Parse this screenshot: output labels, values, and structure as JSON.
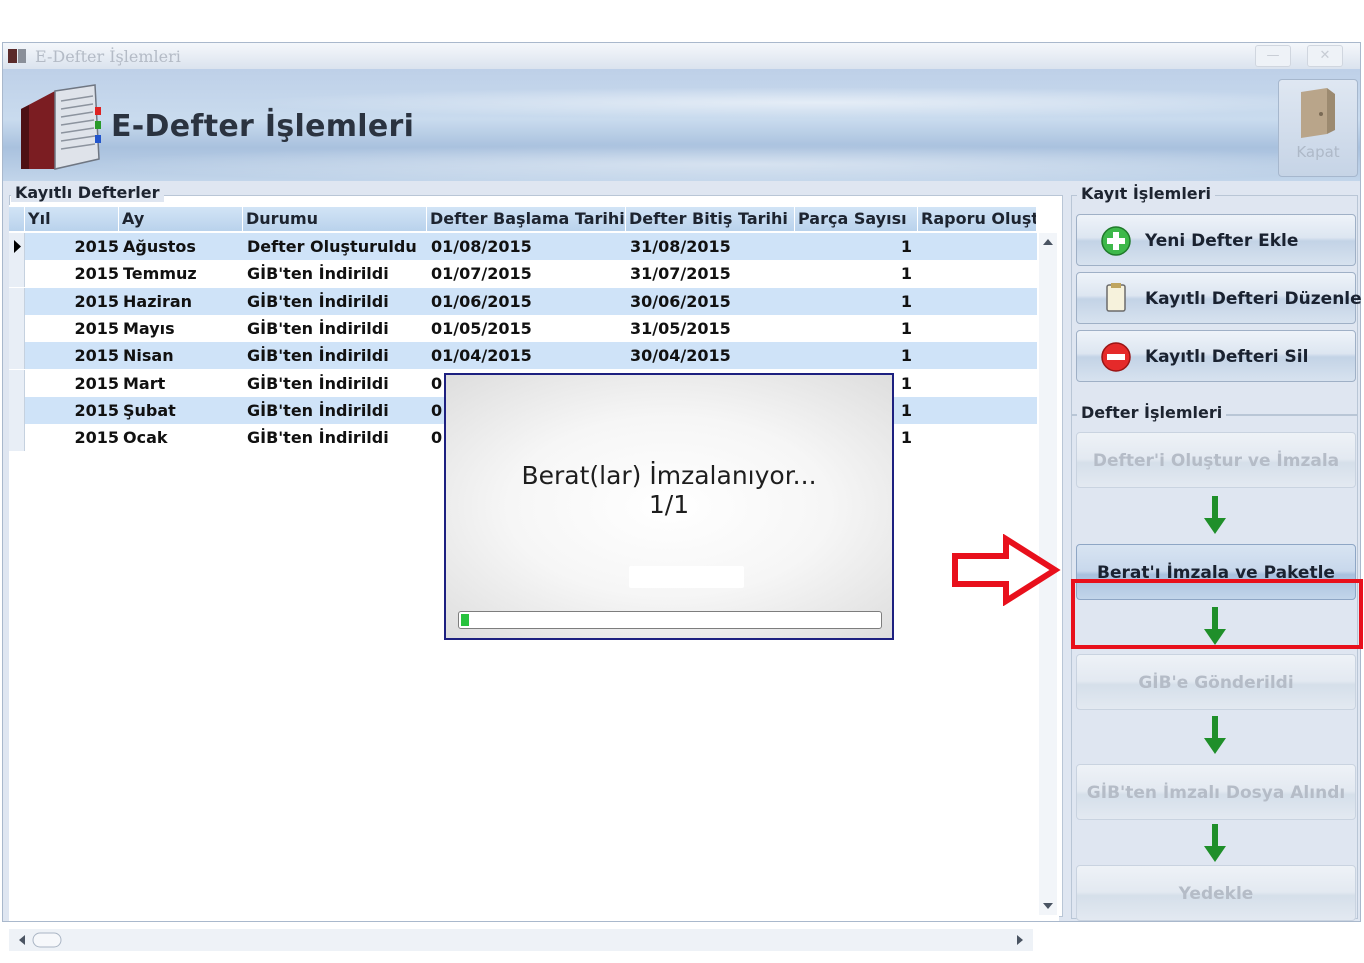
{
  "window": {
    "title": "E-Defter İşlemleri",
    "header_title": "E-Defter İşlemleri",
    "close_label": "Kapat",
    "minimize_glyph": "—",
    "close_glyph": "✕"
  },
  "grid": {
    "section_label": "Kayıtlı Defterler",
    "columns": [
      "Yıl",
      "Ay",
      "Durumu",
      "Defter Başlama Tarihi",
      "Defter Bitiş Tarihi",
      "Parça Sayısı",
      "Raporu Oluşt"
    ],
    "rows": [
      {
        "yil": "2015",
        "ay": "Ağustos",
        "durum": "Defter Oluşturuldu",
        "baslama": "01/08/2015",
        "bitis": "31/08/2015",
        "parca": "1",
        "rapor": ""
      },
      {
        "yil": "2015",
        "ay": "Temmuz",
        "durum": "GİB'ten İndirildi",
        "baslama": "01/07/2015",
        "bitis": "31/07/2015",
        "parca": "1",
        "rapor": ""
      },
      {
        "yil": "2015",
        "ay": "Haziran",
        "durum": "GİB'ten İndirildi",
        "baslama": "01/06/2015",
        "bitis": "30/06/2015",
        "parca": "1",
        "rapor": ""
      },
      {
        "yil": "2015",
        "ay": "Mayıs",
        "durum": "GİB'ten İndirildi",
        "baslama": "01/05/2015",
        "bitis": "31/05/2015",
        "parca": "1",
        "rapor": ""
      },
      {
        "yil": "2015",
        "ay": "Nisan",
        "durum": "GİB'ten İndirildi",
        "baslama": "01/04/2015",
        "bitis": "30/04/2015",
        "parca": "1",
        "rapor": ""
      },
      {
        "yil": "2015",
        "ay": "Mart",
        "durum": "GİB'ten İndirildi",
        "baslama": "0",
        "bitis": "",
        "parca": "1",
        "rapor": ""
      },
      {
        "yil": "2015",
        "ay": "Şubat",
        "durum": "GİB'ten İndirildi",
        "baslama": "0",
        "bitis": "",
        "parca": "1",
        "rapor": ""
      },
      {
        "yil": "2015",
        "ay": "Ocak",
        "durum": "GİB'ten İndirildi",
        "baslama": "0",
        "bitis": "",
        "parca": "1",
        "rapor": ""
      }
    ]
  },
  "modal": {
    "message": "Berat(lar) İmzalanıyor...",
    "progress_text": "1/1",
    "progress_fraction": 0.02
  },
  "kayit_islemleri": {
    "label": "Kayıt İşlemleri",
    "buttons": [
      "Yeni Defter Ekle",
      "Kayıtlı Defteri Düzenle",
      "Kayıtlı Defteri Sil"
    ]
  },
  "defter_islemleri": {
    "label": "Defter İşlemleri",
    "steps": [
      {
        "label": "Defter'i Oluştur ve İmzala",
        "enabled": false
      },
      {
        "label": "Berat'ı İmzala ve Paketle",
        "enabled": true
      },
      {
        "label": "GİB'e Gönderildi",
        "enabled": false
      },
      {
        "label": "GİB'ten İmzalı Dosya Alındı",
        "enabled": false
      },
      {
        "label": "Yedekle",
        "enabled": false
      }
    ]
  },
  "colors": {
    "accent_red": "#e8101c",
    "row_alt": "#cfe3f8",
    "progress_green": "#27c23d",
    "modal_border": "#1d2080"
  }
}
